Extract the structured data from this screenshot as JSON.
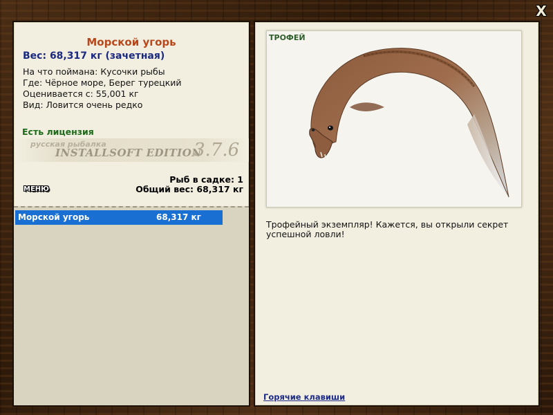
{
  "window": {
    "close_label": "X"
  },
  "fish": {
    "name": "Морской угорь",
    "weight_line": "Вес: 68,317 кг (зачетная)",
    "bait_line": "На что поймана: Кусочки рыбы",
    "location_line": "Где: Чёрное море, Берег турецкий",
    "value_line": "Оценивается с: 55,001 кг",
    "rarity_line": "Вид: Ловится очень редко"
  },
  "license_label": "Есть лицензия",
  "watermark": {
    "line1": "русская рыбалка",
    "line2": "INSTALLSOFT EDITION",
    "version": "3.7.6"
  },
  "menu_label": "МЕНЮ",
  "keepnet": {
    "count_line": "Рыб в садке: 1",
    "total_line": "Общий вес: 68,317 кг",
    "items": [
      {
        "name": "Морской угорь",
        "weight": "68,317 кг"
      }
    ]
  },
  "trophy": {
    "badge": "ТРОФЕЙ",
    "description": "Трофейный экземпляр! Кажется, вы открыли секрет успешной ловли!"
  },
  "hotkeys_label": "Горячие клавиши",
  "colors": {
    "title": "#b8481c",
    "weight": "#1b2a80",
    "license": "#1d6a1a",
    "selection": "#1a6fd2",
    "panel_bg": "#f2efe0"
  },
  "icons": [
    "close-icon",
    "eel-trophy-image"
  ]
}
